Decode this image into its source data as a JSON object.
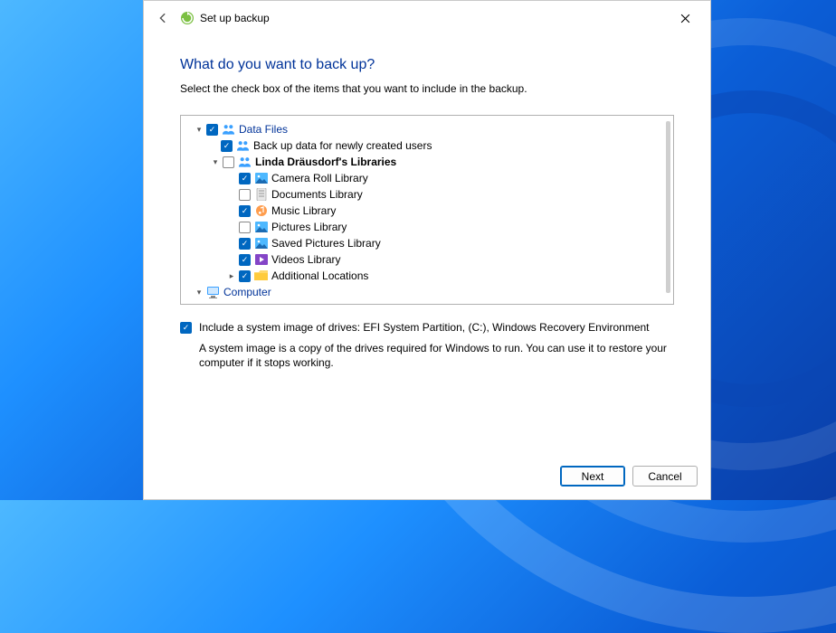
{
  "titlebar": {
    "title": "Set up backup"
  },
  "heading": "What do you want to back up?",
  "instruction": "Select the check box of the items that you want to include in the backup.",
  "tree": {
    "data_files": {
      "label": "Data Files",
      "checked": true,
      "new_users": {
        "label": "Back up data for newly created users",
        "checked": true
      },
      "user_libs": {
        "label": "Linda Dräusdorf's Libraries",
        "checked": false,
        "items": [
          {
            "label": "Camera Roll Library",
            "checked": true,
            "icon": "picture"
          },
          {
            "label": "Documents Library",
            "checked": false,
            "icon": "document"
          },
          {
            "label": "Music Library",
            "checked": true,
            "icon": "music"
          },
          {
            "label": "Pictures Library",
            "checked": false,
            "icon": "picture"
          },
          {
            "label": "Saved Pictures Library",
            "checked": true,
            "icon": "picture"
          },
          {
            "label": "Videos Library",
            "checked": true,
            "icon": "video"
          }
        ],
        "additional": {
          "label": "Additional Locations",
          "checked": true
        }
      }
    },
    "computer": {
      "label": "Computer"
    }
  },
  "system_image": {
    "checked": true,
    "label": "Include a system image of drives: EFI System Partition, (C:), Windows Recovery Environment",
    "description": "A system image is a copy of the drives required for Windows to run. You can use it to restore your computer if it stops working."
  },
  "buttons": {
    "next": "Next",
    "cancel": "Cancel"
  }
}
